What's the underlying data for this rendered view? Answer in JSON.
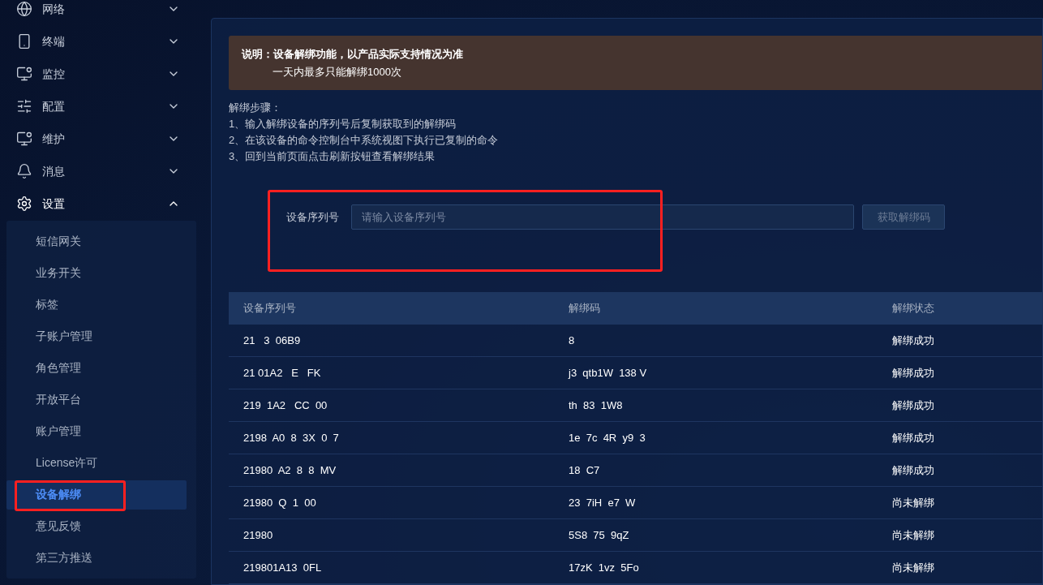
{
  "sidebar": {
    "items": [
      {
        "label": "网络",
        "expanded": false
      },
      {
        "label": "终端",
        "expanded": false
      },
      {
        "label": "监控",
        "expanded": false
      },
      {
        "label": "配置",
        "expanded": false
      },
      {
        "label": "维护",
        "expanded": false
      },
      {
        "label": "消息",
        "expanded": false
      },
      {
        "label": "设置",
        "expanded": true,
        "children": [
          {
            "label": "短信网关",
            "selected": false
          },
          {
            "label": "业务开关",
            "selected": false
          },
          {
            "label": "标签",
            "selected": false
          },
          {
            "label": "子账户管理",
            "selected": false
          },
          {
            "label": "角色管理",
            "selected": false
          },
          {
            "label": "开放平台",
            "selected": false
          },
          {
            "label": "账户管理",
            "selected": false
          },
          {
            "label": "License许可",
            "selected": false
          },
          {
            "label": "设备解绑",
            "selected": true,
            "highlighted": true
          },
          {
            "label": "意见反馈",
            "selected": false
          },
          {
            "label": "第三方推送",
            "selected": false
          }
        ]
      }
    ]
  },
  "notice": {
    "lines": [
      "说明：设备解绑功能，以产品实际支持情况为准",
      "一天内最多只能解绑1000次"
    ]
  },
  "steps": [
    "解绑步骤：",
    "1、输入解绑设备的序列号后复制获取到的解绑码",
    "2、在该设备的命令控制台中系统视图下执行已复制的命令",
    "3、回到当前页面点击刷新按钮查看解绑结果"
  ],
  "form": {
    "highlighted": true,
    "label": "设备序列号",
    "placeholder": "请输入设备序列号",
    "button": {
      "label": "获取解绑码",
      "disabled": true
    }
  },
  "table": {
    "columns": [
      "设备序列号",
      "解绑码",
      "解绑状态"
    ],
    "rows": [
      [
        "21   3  06B9",
        "8",
        "解绑成功"
      ],
      [
        "21 01A2   E   FK",
        "j3  qtb1W  138 V",
        "解绑成功"
      ],
      [
        "219  1A2   CC  00",
        "th  83  1W8",
        "解绑成功"
      ],
      [
        "2198  A0  8  3X  0  7",
        "1e  7c  4R  y9  3",
        "解绑成功"
      ],
      [
        "21980  A2  8  8  MV",
        "18  C7",
        "解绑成功"
      ],
      [
        "21980  Q  1  00",
        "23  7iH  e7  W",
        "尚未解绑"
      ],
      [
        "21980",
        "5S8  75  9qZ",
        "尚未解绑"
      ],
      [
        "219801A13  0FL",
        "17zK  1vz  5Fo",
        "尚未解绑"
      ]
    ]
  }
}
